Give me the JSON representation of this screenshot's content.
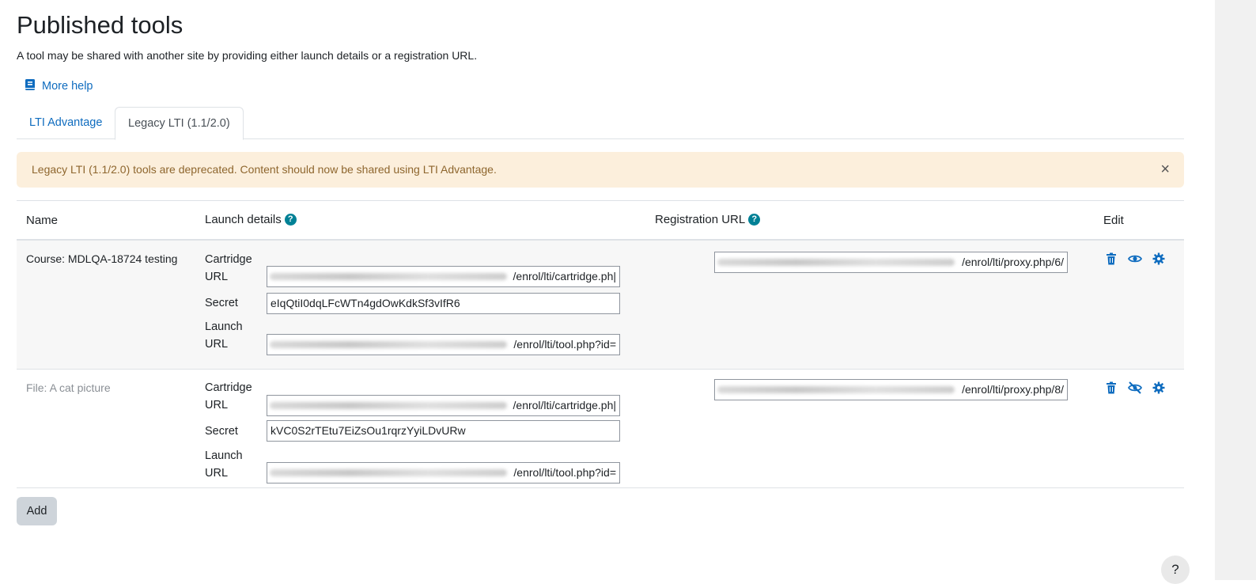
{
  "page": {
    "title": "Published tools",
    "description": "A tool may be shared with another site by providing either launch details or a registration URL.",
    "help_link": "More help"
  },
  "tabs": [
    {
      "label": "LTI Advantage",
      "active": false
    },
    {
      "label": "Legacy LTI (1.1/2.0)",
      "active": true
    }
  ],
  "alert": {
    "message": "Legacy LTI (1.1/2.0) tools are deprecated. Content should now be shared using LTI Advantage.",
    "close": "×"
  },
  "table": {
    "headers": {
      "name": "Name",
      "launch": "Launch details",
      "registration": "Registration URL",
      "edit": "Edit"
    },
    "labels": {
      "cartridge_line1": "Cartridge",
      "cartridge_line2": "URL",
      "secret": "Secret",
      "launch_line1": "Launch",
      "launch_line2": "URL"
    },
    "rows": [
      {
        "name": "Course: MDLQA-18724 testing",
        "cartridge_url": "/enrol/lti/cartridge.ph|",
        "secret": "eIqQtiI0dqLFcWTn4gdOwKdkSf3vIfR6",
        "launch_url": "/enrol/lti/tool.php?id=",
        "registration_url": "/enrol/lti/proxy.php/6/",
        "visible": true
      },
      {
        "name": "File: A cat picture",
        "cartridge_url": "/enrol/lti/cartridge.ph|",
        "secret": "kVC0S2rTEtu7EiZsOu1rqrzYyiLDvURw",
        "launch_url": "/enrol/lti/tool.php?id=",
        "registration_url": "/enrol/lti/proxy.php/8/",
        "visible": false
      }
    ]
  },
  "buttons": {
    "add": "Add",
    "help_fab": "?"
  },
  "colors": {
    "link": "#0f6cbf",
    "alert_bg": "#fcefdc",
    "alert_text": "#8e662e",
    "help_icon": "#008196"
  }
}
